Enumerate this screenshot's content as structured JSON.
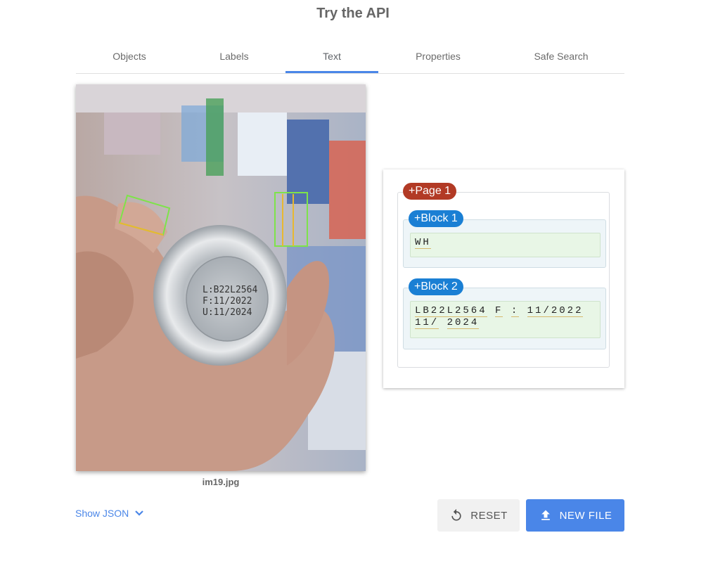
{
  "header": {
    "title": "Try the API"
  },
  "tabs": [
    {
      "label": "Objects"
    },
    {
      "label": "Labels"
    },
    {
      "label": "Text",
      "active": true
    },
    {
      "label": "Properties"
    },
    {
      "label": "Safe Search"
    }
  ],
  "image": {
    "filename": "im19.jpg",
    "can_text": [
      "L:B22L2564",
      "F:11/2022",
      "U:11/2024"
    ]
  },
  "result": {
    "page_label": "+Page 1",
    "blocks": [
      {
        "label": "+Block 1",
        "words": [
          "WH"
        ]
      },
      {
        "label": "+Block 2",
        "words": [
          "LB22L2564",
          "F",
          ":",
          "11/2022",
          "11/",
          "2024"
        ]
      }
    ]
  },
  "footer": {
    "show_json": "Show JSON",
    "reset": "RESET",
    "new_file": "NEW FILE"
  },
  "colors": {
    "accent": "#4a86e8",
    "page_pill": "#b23a25",
    "block_pill": "#1a7fd4"
  }
}
